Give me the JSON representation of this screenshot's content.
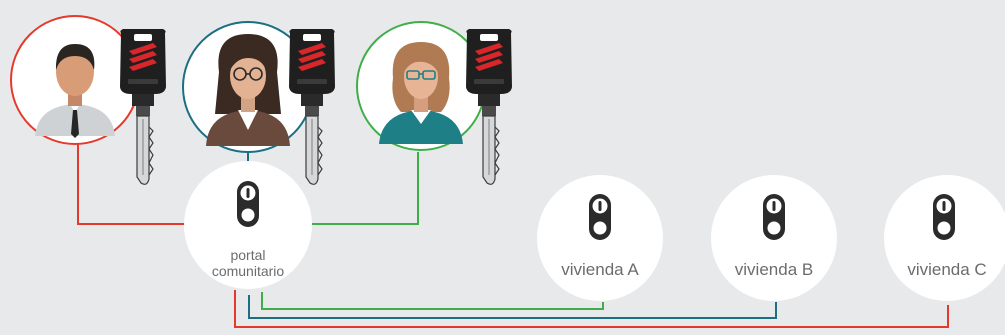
{
  "portal": {
    "label_line1": "portal",
    "label_line2": "comunitario"
  },
  "dwellings": [
    {
      "label": "vivienda A"
    },
    {
      "label": "vivienda B"
    },
    {
      "label": "vivienda C"
    }
  ],
  "colors": {
    "background": "#e8e9eb",
    "red": "#e5392c",
    "teal": "#1b6f82",
    "green": "#3fae49",
    "node": "#ffffff",
    "cylinder": "#2b2b2b",
    "label": "#6a6d70"
  },
  "keys": [
    {
      "icon": "key-icon",
      "brand_mark": "red"
    },
    {
      "icon": "key-icon",
      "brand_mark": "red"
    },
    {
      "icon": "key-icon",
      "brand_mark": "red"
    }
  ]
}
